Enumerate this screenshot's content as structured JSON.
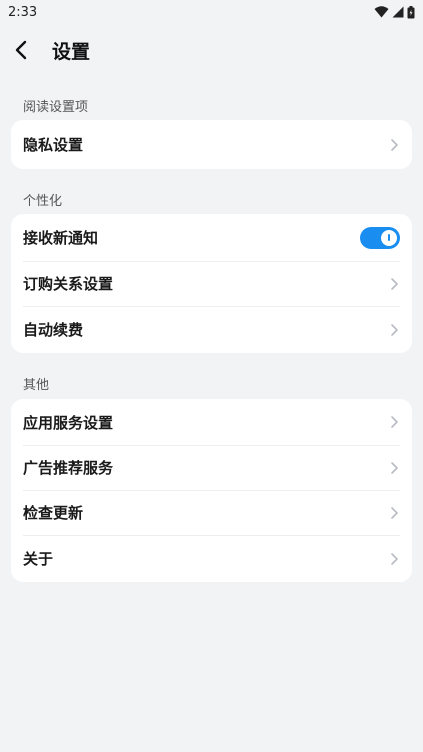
{
  "status_bar": {
    "time": "2:33",
    "icons": [
      "wifi-icon",
      "signal-icon",
      "battery-icon"
    ]
  },
  "header": {
    "back_icon": "chevron-left-icon",
    "title": "设置"
  },
  "sections": [
    {
      "label": "阅读设置项",
      "items": [
        {
          "label": "隐私设置",
          "control": "chevron"
        }
      ]
    },
    {
      "label": "个性化",
      "items": [
        {
          "label": "接收新通知",
          "control": "toggle",
          "toggle_on": true
        },
        {
          "label": "订购关系设置",
          "control": "chevron"
        },
        {
          "label": "自动续费",
          "control": "chevron"
        }
      ]
    },
    {
      "label": "其他",
      "items": [
        {
          "label": "应用服务设置",
          "control": "chevron"
        },
        {
          "label": "广告推荐服务",
          "control": "chevron"
        },
        {
          "label": "检查更新",
          "control": "chevron"
        },
        {
          "label": "关于",
          "control": "chevron"
        }
      ]
    }
  ],
  "colors": {
    "background": "#f1f3f5",
    "card": "#ffffff",
    "accent": "#1a8ef0",
    "chevron": "#b8bcc2"
  }
}
